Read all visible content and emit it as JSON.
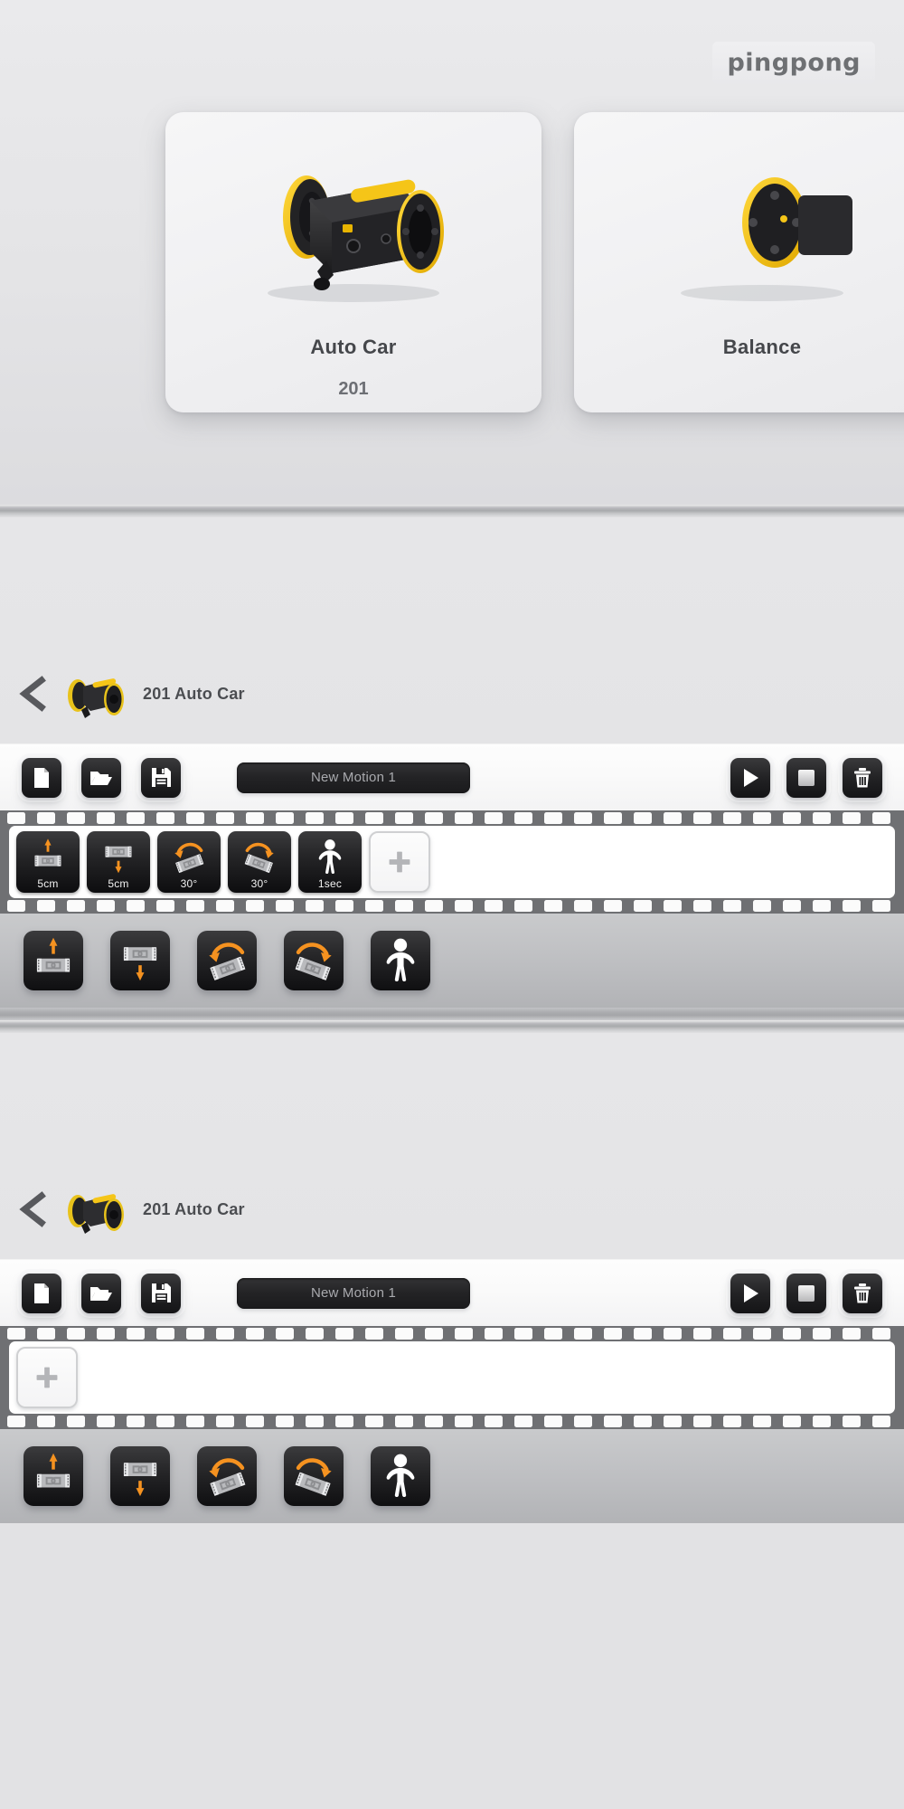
{
  "brand": {
    "name": "pingpong"
  },
  "model_select": {
    "cards": [
      {
        "title": "Auto Car",
        "code": "201",
        "image_icon": "auto-car-robot-icon"
      },
      {
        "title": "Balance",
        "code": "",
        "image_icon": "balance-robot-icon"
      }
    ]
  },
  "editor_top": {
    "back_icon": "chevron-left-icon",
    "thumb_icon": "auto-car-robot-icon",
    "title": "201 Auto Car",
    "toolbar": {
      "new_label": "new-file-icon",
      "open_label": "open-folder-icon",
      "save_label": "floppy-save-icon",
      "motion_name": "New Motion 1",
      "play_label": "play-icon",
      "stop_label": "stop-icon",
      "delete_label": "trash-icon"
    },
    "timeline": {
      "add_icon": "plus-icon",
      "frames": [
        {
          "icon": "move-forward-icon",
          "label": "5cm"
        },
        {
          "icon": "move-backward-icon",
          "label": "5cm"
        },
        {
          "icon": "turn-left-icon",
          "label": "30°"
        },
        {
          "icon": "turn-right-icon",
          "label": "30°"
        },
        {
          "icon": "wait-person-icon",
          "label": "1sec"
        }
      ]
    },
    "palette": [
      {
        "icon": "move-forward-icon",
        "name": "move-forward"
      },
      {
        "icon": "move-backward-icon",
        "name": "move-backward"
      },
      {
        "icon": "turn-left-icon",
        "name": "turn-left"
      },
      {
        "icon": "turn-right-icon",
        "name": "turn-right"
      },
      {
        "icon": "wait-person-icon",
        "name": "wait"
      }
    ]
  },
  "editor_bottom": {
    "back_icon": "chevron-left-icon",
    "thumb_icon": "auto-car-robot-icon",
    "title": "201 Auto Car",
    "toolbar": {
      "motion_name": "New Motion 1"
    },
    "timeline": {
      "add_icon": "plus-icon",
      "frames": []
    },
    "palette": [
      {
        "icon": "move-forward-icon",
        "name": "move-forward"
      },
      {
        "icon": "move-backward-icon",
        "name": "move-backward"
      },
      {
        "icon": "turn-left-icon",
        "name": "turn-left"
      },
      {
        "icon": "turn-right-icon",
        "name": "turn-right"
      },
      {
        "icon": "wait-person-icon",
        "name": "wait"
      }
    ]
  },
  "colors": {
    "accent_orange": "#F59220",
    "robot_yellow": "#F5C518",
    "panel_dark": "#1d1d1f",
    "film_gray": "#6f7073",
    "page_bg": "#e2e2e4"
  }
}
